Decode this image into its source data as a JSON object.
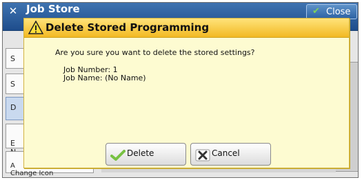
{
  "window": {
    "title": "Job Store",
    "close_label": "Close"
  },
  "sidebar": {
    "items": [
      {
        "label": "S"
      },
      {
        "label": "S"
      },
      {
        "label": "D"
      },
      {
        "label": "E\nN"
      },
      {
        "label": "A\nChange Icon"
      }
    ]
  },
  "dialog": {
    "title": "Delete Stored Programming",
    "message": "Are you sure you want to delete the stored settings?",
    "job_number": "Job Number: 1",
    "job_name": "Job Name: (No Name)",
    "delete_label": "Delete",
    "cancel_label": "Cancel",
    "warning_icon": "warning-triangle-icon",
    "delete_icon": "checkmark-icon",
    "cancel_icon": "x-icon"
  },
  "colors": {
    "header_blue": "#2a5b9a",
    "dialog_bg": "#fdfbd1",
    "dialog_header": "#f4c12b"
  }
}
